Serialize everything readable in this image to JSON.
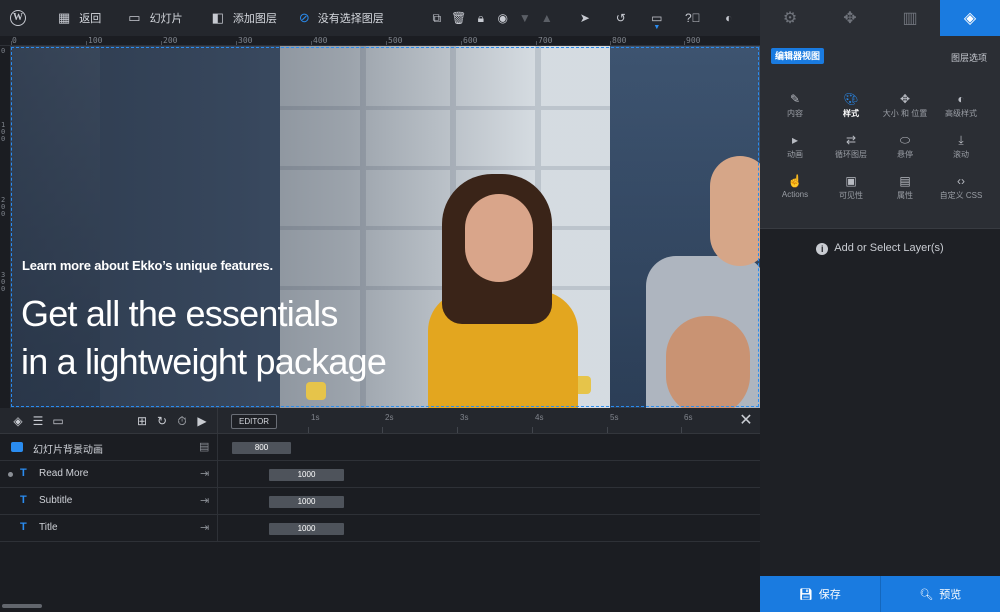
{
  "topbar": {
    "back_label": "返回",
    "slides_label": "幻灯片",
    "add_layer_label": "添加图层",
    "no_layer_label": "没有选择图层"
  },
  "right_tabs": [
    {
      "icon": "gear-icon"
    },
    {
      "icon": "gamepad-icon"
    },
    {
      "icon": "image-stack-icon"
    },
    {
      "icon": "layers-icon",
      "active": true
    }
  ],
  "ruler": {
    "top": [
      "0",
      "100",
      "200",
      "300",
      "400",
      "500",
      "600",
      "700",
      "800",
      "900"
    ],
    "left": [
      "0",
      "100",
      "200",
      "300"
    ]
  },
  "hero": {
    "small_text": "Learn more about Ekko’s unique features.",
    "big_line1": "Get all the essentials",
    "big_line2": "in a lightweight package"
  },
  "timeline": {
    "editor_label": "EDITOR",
    "marks": [
      "1s",
      "2s",
      "3s",
      "4s",
      "5s",
      "6s"
    ],
    "rows": [
      {
        "name": "幻灯片背景动画",
        "value": "800",
        "type": "image"
      },
      {
        "name": "Read More",
        "value": "1000",
        "type": "text"
      },
      {
        "name": "Subtitle",
        "value": "1000",
        "type": "text"
      },
      {
        "name": "Title",
        "value": "1000",
        "type": "text"
      }
    ]
  },
  "panel": {
    "editor_view_label": "编辑器视图",
    "layer_options_label": "图层选项",
    "grid": [
      {
        "label": "内容",
        "icon": "pencil-icon"
      },
      {
        "label": "样式",
        "icon": "palette-icon",
        "active": true
      },
      {
        "label": "大小 和 位置",
        "icon": "move-icon"
      },
      {
        "label": "高级样式",
        "icon": "contrast-icon"
      },
      {
        "label": "动画",
        "icon": "play-icon"
      },
      {
        "label": "循环图层",
        "icon": "loop-icon"
      },
      {
        "label": "悬停",
        "icon": "mouse-icon"
      },
      {
        "label": "滚动",
        "icon": "scroll-icon"
      },
      {
        "label": "Actions",
        "icon": "pointer-hand-icon"
      },
      {
        "label": "可见性",
        "icon": "visibility-icon"
      },
      {
        "label": "属性",
        "icon": "file-icon"
      },
      {
        "label": "自定义 CSS",
        "icon": "code-icon"
      }
    ],
    "add_select_label": "Add or Select Layer(s)",
    "save_label": "保存",
    "preview_label": "预览"
  },
  "colors": {
    "accent": "#1a7be0",
    "background": "#1b1d22",
    "toolbar": "#24272d"
  }
}
